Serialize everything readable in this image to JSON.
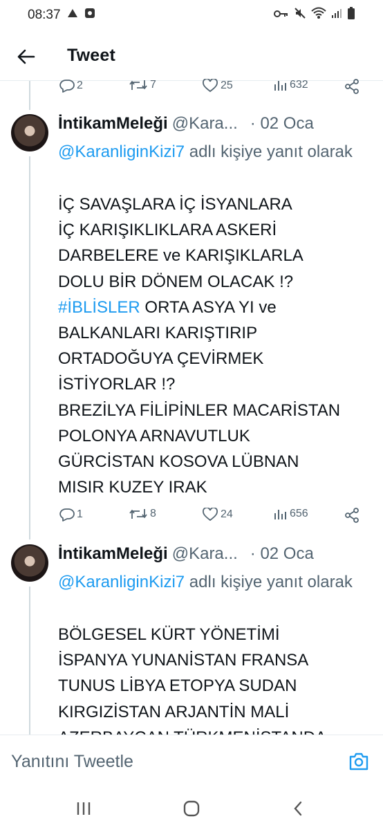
{
  "status_bar": {
    "time": "08:37"
  },
  "header": {
    "title": "Tweet"
  },
  "previous_tweet_actions": {
    "replies": "2",
    "retweets": "7",
    "likes": "25",
    "views": "632"
  },
  "tweets": [
    {
      "author_name": "İntikamMeleği",
      "author_handle": "@Kara...",
      "date": "· 02 Oca",
      "reply_link": "@KaranliginKizi7",
      "reply_suffix": " adlı kişiye yanıt olarak",
      "text_before_hashtag": "İÇ SAVAŞLARA İÇ İSYANLARA\nİÇ KARIŞIKLIKLARA ASKERİ\nDARBELERE ve KARIŞIKLARLA\nDOLU BİR DÖNEM OLACAK !?\n",
      "hashtag": "#İBLİSLER",
      "text_after_hashtag": " ORTA ASYA YI ve\nBALKANLARI KARIŞTIRIP\nORTADOĞUYA ÇEVİRMEK\nİSTİYORLAR !?\nBREZİLYA FİLİPİNLER MACARİSTAN\nPOLONYA ARNAVUTLUK\nGÜRCİSTAN KOSOVA LÜBNAN\nMISIR KUZEY IRAK",
      "replies": "1",
      "retweets": "8",
      "likes": "24",
      "views": "656"
    },
    {
      "author_name": "İntikamMeleği",
      "author_handle": "@Kara...",
      "date": "· 02 Oca",
      "reply_link": "@KaranliginKizi7",
      "reply_suffix": " adlı kişiye yanıt olarak",
      "text": "BÖLGESEL KÜRT YÖNETİMİ\nİSPANYA YUNANİSTAN FRANSA\nTUNUS LİBYA ETOPYA SUDAN\nKIRGIZİSTAN ARJANTİN MALİ\nAZERBAYCAN TÜRKMENİSTANDA"
    }
  ],
  "reply_bar": {
    "placeholder": "Yanıtını Tweetle"
  },
  "colors": {
    "link": "#1d9bf0",
    "text": "#0f1419",
    "secondary": "#536471"
  }
}
